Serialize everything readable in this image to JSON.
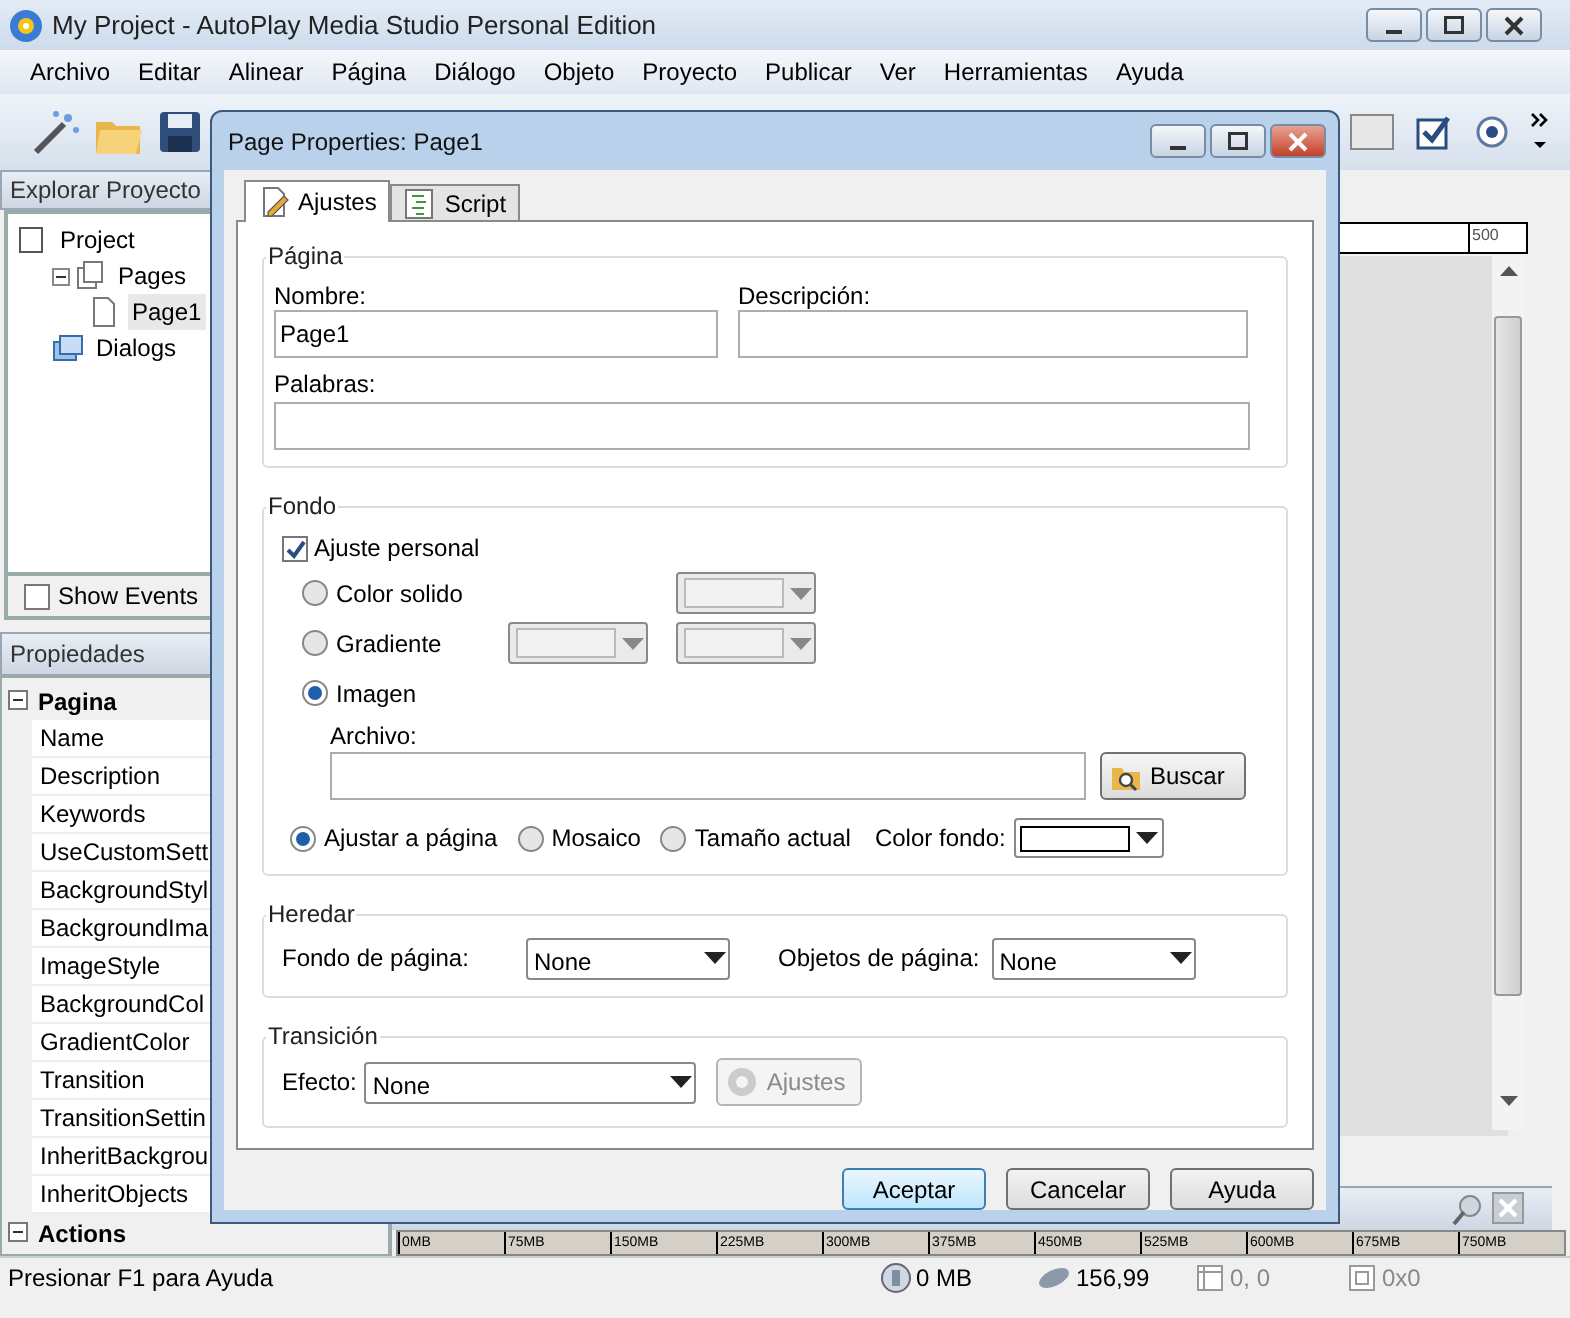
{
  "window": {
    "title": "My Project - AutoPlay Media Studio Personal Edition"
  },
  "menu": [
    "Archivo",
    "Editar",
    "Alinear",
    "Página",
    "Diálogo",
    "Objeto",
    "Proyecto",
    "Publicar",
    "Ver",
    "Herramientas",
    "Ayuda"
  ],
  "explorer": {
    "title": "Explorar Proyecto",
    "tree": [
      {
        "label": "Project",
        "kind": "project",
        "selected": false,
        "children": [
          {
            "label": "Pages",
            "kind": "pages",
            "selected": false,
            "expanded": true,
            "children": [
              {
                "label": "Page1",
                "kind": "page",
                "selected": true
              }
            ]
          },
          {
            "label": "Dialogs",
            "kind": "dialogs",
            "selected": false
          }
        ]
      }
    ],
    "show_events": {
      "label": "Show Events",
      "checked": false
    }
  },
  "properties": {
    "title": "Propiedades",
    "groups": [
      {
        "label": "Pagina",
        "expanded": true,
        "items": [
          "Name",
          "Description",
          "Keywords",
          "UseCustomSett",
          "BackgroundStyl",
          "BackgroundIma",
          "ImageStyle",
          "BackgroundCol",
          "GradientColor",
          "Transition",
          "TransitionSettin",
          "InheritBackgrou",
          "InheritObjects"
        ]
      },
      {
        "label": "Actions",
        "expanded": true
      }
    ]
  },
  "ruler": {
    "label": "500"
  },
  "memory_ruler": {
    "labels": [
      "0MB",
      "75MB",
      "150MB",
      "225MB",
      "300MB",
      "375MB",
      "450MB",
      "525MB",
      "600MB",
      "675MB",
      "750MB"
    ]
  },
  "status_bar": {
    "help": "Presionar F1 para Ayuda",
    "memory": "0 MB",
    "disk": "156,99",
    "position": "0, 0",
    "size": "0x0"
  },
  "dialog": {
    "title": "Page Properties: Page1",
    "tabs": [
      {
        "label": "Ajustes",
        "selected": true,
        "kind": "settings"
      },
      {
        "label": "Script",
        "selected": false,
        "kind": "script"
      }
    ],
    "pagina": {
      "title": "Página",
      "name_label": "Nombre:",
      "name_value": "Page1",
      "description_label": "Descripción:",
      "keywords_label": "Palabras:"
    },
    "fondo": {
      "title": "Fondo",
      "custom": {
        "label": "Ajuste personal",
        "checked": true
      },
      "fill_options": [
        {
          "label": "Color solido",
          "selected": false,
          "kind": "solid"
        },
        {
          "label": "Gradiente",
          "selected": false,
          "kind": "gradient"
        },
        {
          "label": "Imagen",
          "selected": true,
          "kind": "image"
        }
      ],
      "file_label": "Archivo:",
      "browse": "Buscar",
      "image_style": [
        {
          "label": "Ajustar a página",
          "selected": true
        },
        {
          "label": "Mosaico",
          "selected": false
        },
        {
          "label": "Tamaño actual",
          "selected": false
        }
      ],
      "color_label": "Color fondo:",
      "color": "#ffffff"
    },
    "heredar": {
      "title": "Heredar",
      "fields": [
        {
          "label": "Fondo de página:",
          "value": "None"
        },
        {
          "label": "Objetos de página:",
          "value": "None"
        }
      ]
    },
    "transicion": {
      "title": "Transición",
      "effect_label": "Efecto:",
      "effect_value": "None",
      "settings": {
        "label": "Ajustes",
        "disabled": true
      }
    },
    "buttons": [
      {
        "label": "Aceptar",
        "default": true
      },
      {
        "label": "Cancelar",
        "default": false
      },
      {
        "label": "Ayuda",
        "default": false
      }
    ]
  }
}
